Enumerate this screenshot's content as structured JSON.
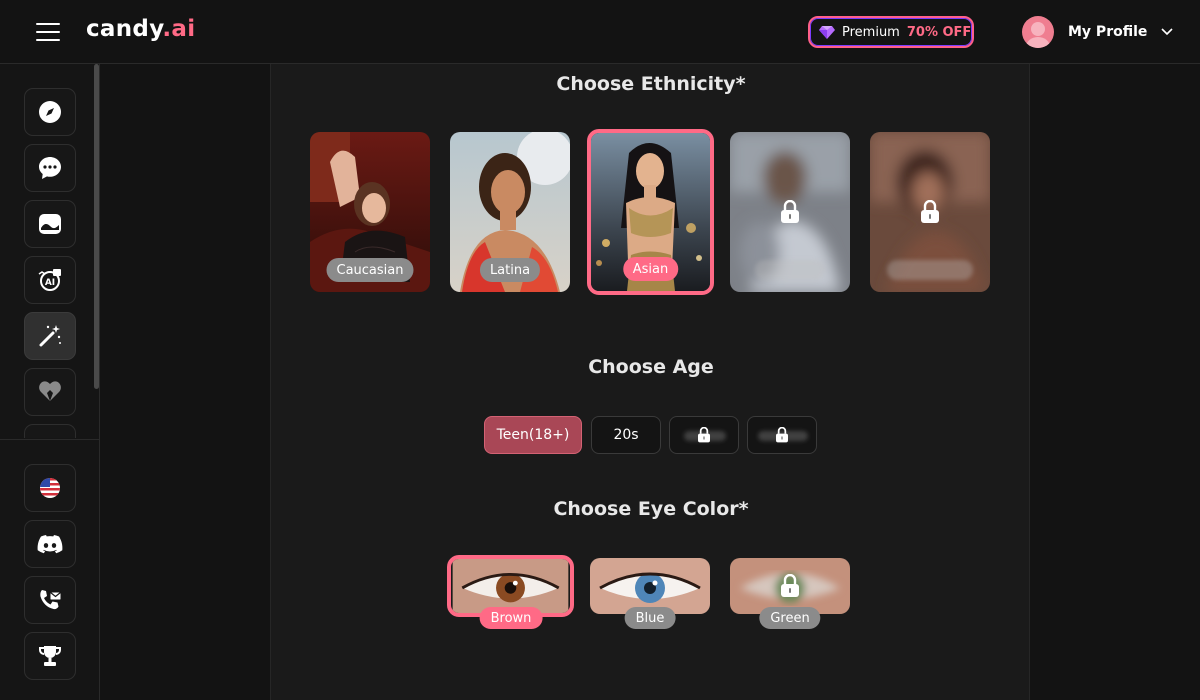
{
  "app": {
    "logo_main": "candy",
    "logo_ai": ".ai"
  },
  "header": {
    "premium_label": "Premium",
    "premium_discount": "70% OFF",
    "profile_label": "My Profile"
  },
  "sidebar": {
    "items": [
      {
        "name": "explore",
        "icon": "compass-icon"
      },
      {
        "name": "chat",
        "icon": "chat-bubble-icon"
      },
      {
        "name": "gallery",
        "icon": "image-icon"
      },
      {
        "name": "generate-image",
        "icon": "ai-image-icon"
      },
      {
        "name": "create-character",
        "icon": "magic-wand-icon",
        "active": true
      },
      {
        "name": "my-ai",
        "icon": "heart-hands-icon"
      }
    ],
    "bottom_items": [
      {
        "name": "language",
        "icon": "us-flag-icon"
      },
      {
        "name": "discord",
        "icon": "discord-icon"
      },
      {
        "name": "contact",
        "icon": "phone-mail-icon"
      },
      {
        "name": "leaderboard",
        "icon": "trophy-icon"
      }
    ]
  },
  "ethnicity": {
    "title": "Choose Ethnicity*",
    "options": [
      {
        "label": "Caucasian",
        "selected": false,
        "locked": false
      },
      {
        "label": "Latina",
        "selected": false,
        "locked": false
      },
      {
        "label": "Asian",
        "selected": true,
        "locked": false
      },
      {
        "label": "",
        "selected": false,
        "locked": true
      },
      {
        "label": "",
        "selected": false,
        "locked": true
      }
    ]
  },
  "age": {
    "title": "Choose Age",
    "options": [
      {
        "label": "Teen(18+)",
        "selected": true,
        "locked": false
      },
      {
        "label": "20s",
        "selected": false,
        "locked": false
      },
      {
        "label": "",
        "selected": false,
        "locked": true
      },
      {
        "label": "",
        "selected": false,
        "locked": true
      }
    ]
  },
  "eye_color": {
    "title": "Choose Eye Color*",
    "options": [
      {
        "label": "Brown",
        "selected": true,
        "locked": false,
        "iris": "#8a4a22"
      },
      {
        "label": "Blue",
        "selected": false,
        "locked": false,
        "iris": "#4f86b8"
      },
      {
        "label": "Green",
        "selected": false,
        "locked": true,
        "iris": "#6b8a5a"
      }
    ]
  },
  "colors": {
    "accent": "#ff6a86",
    "selected_age": "#a94756",
    "background": "#131313",
    "panel": "#1a1a1a"
  }
}
